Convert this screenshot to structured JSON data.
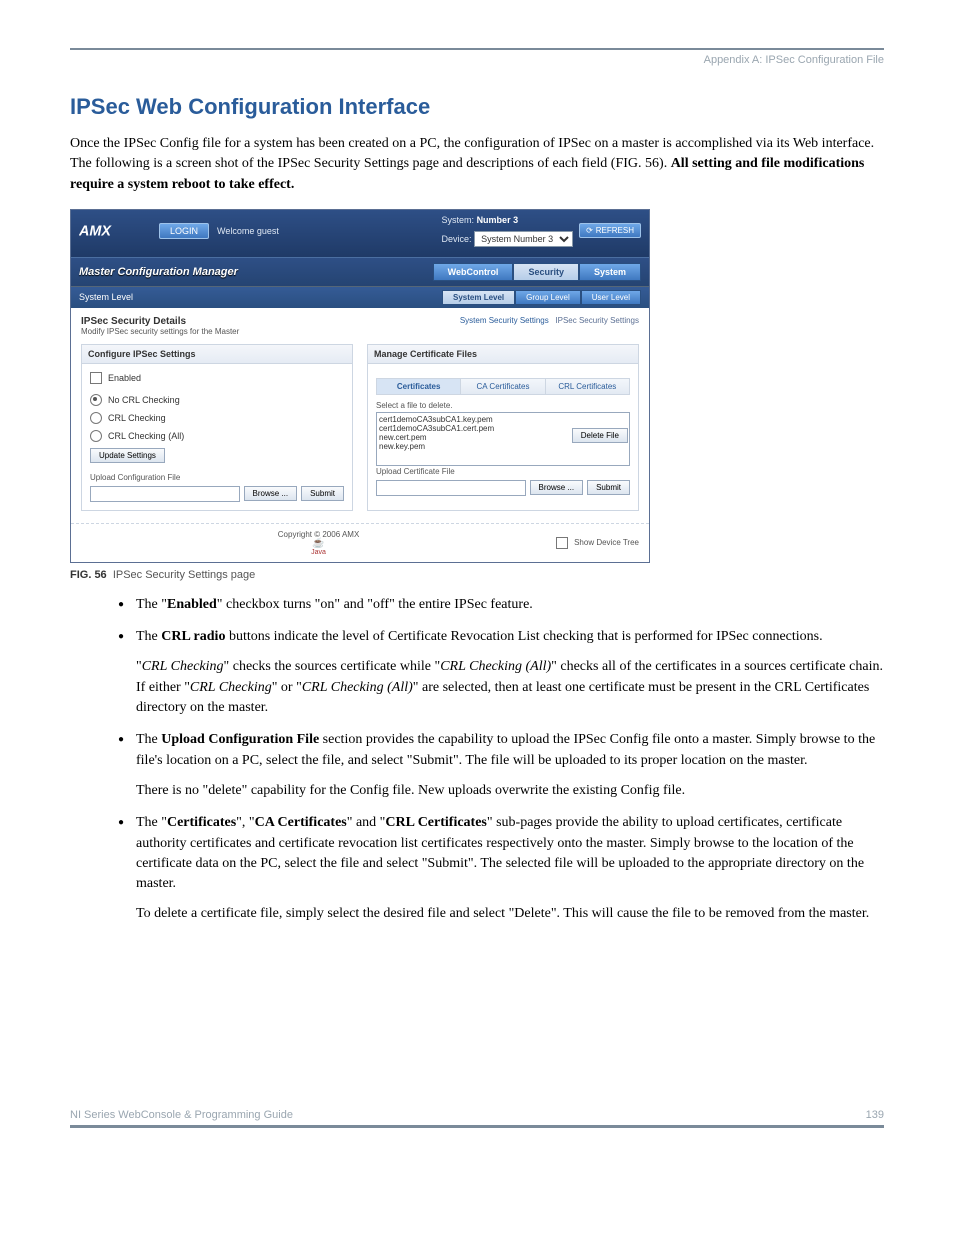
{
  "header": {
    "appendix": "Appendix A: IPSec Configuration File"
  },
  "title": "IPSec Web Configuration Interface",
  "intro": {
    "p1a": "Once the IPSec Config file for a system has been created on a PC, the configuration of IPSec on a master is accomplished via its Web interface. The following is a screen shot of the IPSec Security Settings page and descriptions of each field (FIG. 56). ",
    "p1b": "All setting and file modifications require a system reboot to take effect."
  },
  "figure": {
    "caption_no": "FIG. 56",
    "caption_text": "IPSec Security Settings page"
  },
  "shot": {
    "login": "LOGIN",
    "welcome": "Welcome guest",
    "system_lbl": "System:",
    "system_val": "Number 3",
    "device_lbl": "Device:",
    "device_val": "System Number 3",
    "refresh": "REFRESH",
    "mcm": "Master Configuration Manager",
    "tabs": {
      "web": "WebControl",
      "sec": "Security",
      "sys": "System"
    },
    "syslevel": "System Level",
    "subtabs": {
      "sys": "System Level",
      "grp": "Group Level",
      "usr": "User Level"
    },
    "details_h": "IPSec Security Details",
    "details_sub": "Modify IPSec security settings for the Master",
    "links": {
      "l1": "System Security Settings",
      "l2": "IPSec Security Settings"
    },
    "left": {
      "header": "Configure IPSec Settings",
      "enabled": "Enabled",
      "r1": "No CRL Checking",
      "r2": "CRL Checking",
      "r3": "CRL Checking (All)",
      "update": "Update Settings",
      "upload_h": "Upload Configuration File",
      "browse": "Browse ...",
      "submit": "Submit"
    },
    "right": {
      "header": "Manage Certificate Files",
      "t1": "Certificates",
      "t2": "CA Certificates",
      "t3": "CRL Certificates",
      "select_note": "Select a file to delete.",
      "files": [
        "cert1demoCA3subCA1.key.pem",
        "cert1demoCA3subCA1.cert.pem",
        "new.cert.pem",
        "new.key.pem"
      ],
      "delete": "Delete File",
      "upload_h": "Upload Certificate File",
      "browse": "Browse ...",
      "submit": "Submit"
    },
    "copyright": "Copyright © 2006 AMX",
    "showtree": "Show Device Tree",
    "java": "Java"
  },
  "bullets": {
    "b1a": "The \"",
    "b1b": "Enabled",
    "b1c": "\" checkbox turns \"on\" and \"off\" the entire IPSec feature.",
    "b2a": "The ",
    "b2b": "CRL radio",
    "b2c": " buttons indicate the level of Certificate Revocation List checking that is performed for IPSec connections.",
    "b2p_a": "\"",
    "b2p_b": "CRL Checking",
    "b2p_c": "\" checks the sources certificate while \"",
    "b2p_d": "CRL Checking (All)",
    "b2p_e": "\" checks all of the certificates in a sources certificate chain. If either \"",
    "b2p_f": "CRL Checking",
    "b2p_g": "\" or \"",
    "b2p_h": "CRL Checking (All)",
    "b2p_i": "\" are selected, then at least one certificate must be present in the CRL Certificates directory on the master.",
    "b3a": "The ",
    "b3b": "Upload Configuration File",
    "b3c": " section provides the capability to upload the IPSec Config file onto a master. Simply browse to the file's location on a PC, select the file, and select \"Submit\". The file will be uploaded to its proper location on the master.",
    "b3p": "There is no \"delete\" capability for the Config file. New uploads overwrite the existing Config file.",
    "b4a": "The \"",
    "b4b": "Certificates",
    "b4c": "\", \"",
    "b4d": "CA Certificates",
    "b4e": "\" and \"",
    "b4f": "CRL Certificates",
    "b4g": "\" sub-pages provide the ability to upload certificates, certificate authority certificates and certificate revocation list certificates respectively onto the master. Simply browse to the location of the certificate data on the PC, select the file and select \"Submit\". The selected file will be uploaded to the appropriate directory on the master.",
    "b4p": "To delete a certificate file, simply select the desired file and select \"Delete\". This will cause the file to be removed from the master."
  },
  "footer": {
    "left": "NI Series WebConsole & Programming Guide",
    "right": "139"
  }
}
